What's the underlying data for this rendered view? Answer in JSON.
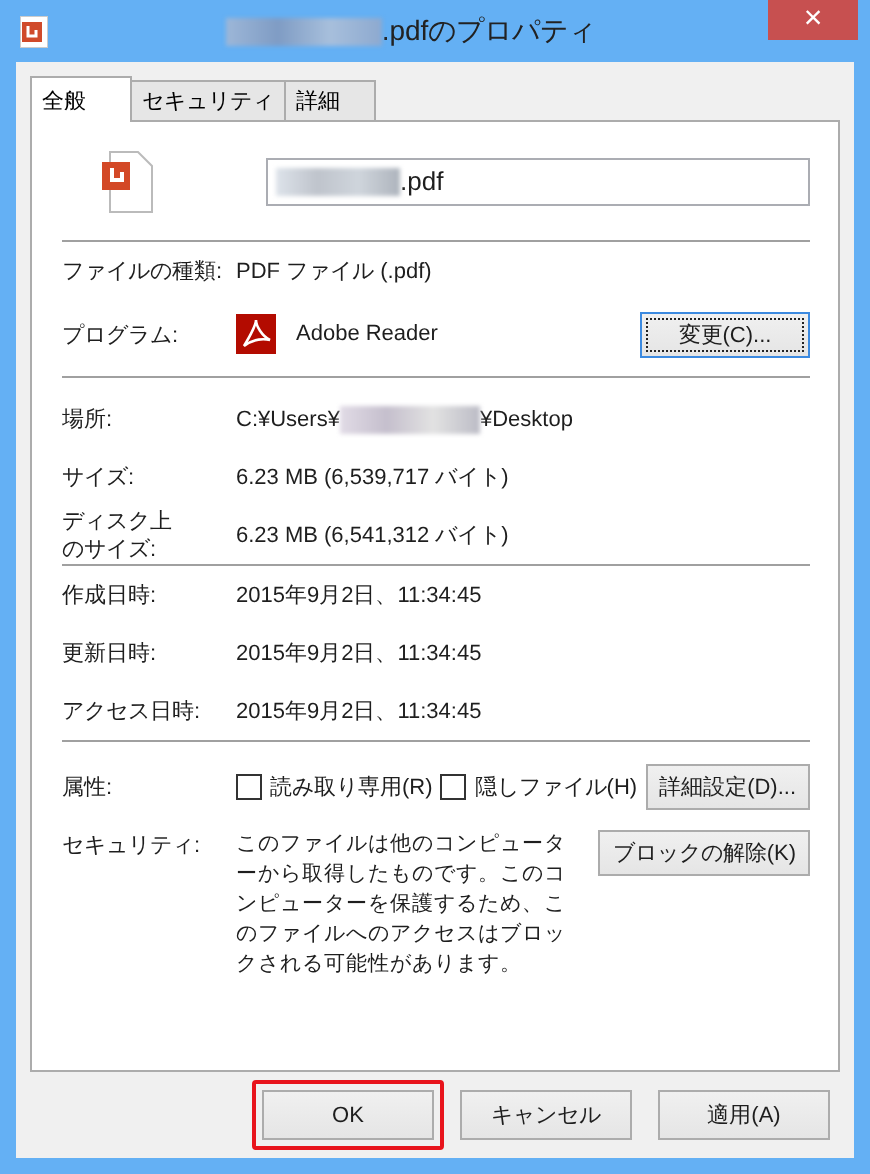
{
  "window": {
    "title": ".pdfのプロパティ",
    "close": "×"
  },
  "tabs": [
    {
      "label": "全般",
      "selected": true
    },
    {
      "label": "セキュリティ",
      "selected": false
    },
    {
      "label": "詳細",
      "selected": false
    }
  ],
  "file": {
    "name": ".pdf"
  },
  "type": {
    "label": "ファイルの種類:",
    "value": "PDF ファイル (.pdf)"
  },
  "program": {
    "label": "プログラム:",
    "value": "Adobe Reader",
    "button": "変更(C)...",
    "button_focused": true
  },
  "location": {
    "label": "場所:",
    "before": "C:¥Users¥",
    "after": "¥Desktop"
  },
  "sizes": [
    {
      "label": "サイズ:",
      "value": "6.23 MB (6,539,717 バイト)"
    },
    {
      "label": "ディスク上のサイズ:",
      "value": "6.23 MB (6,541,312 バイト)"
    }
  ],
  "dates": [
    {
      "label": "作成日時:",
      "value": "2015年9月2日、11:34:45"
    },
    {
      "label": "更新日時:",
      "value": "2015年9月2日、11:34:45"
    },
    {
      "label": "アクセス日時:",
      "value": "2015年9月2日、11:34:45"
    }
  ],
  "attributes": {
    "label": "属性:",
    "checkboxes": [
      {
        "label": "読み取り専用(R)",
        "checked": false
      },
      {
        "label": "隠しファイル(H)",
        "checked": false
      }
    ],
    "button": "詳細設定(D)..."
  },
  "security": {
    "label": "セキュリティ:",
    "text": "このファイルは他のコンピューターから取得したものです。このコンピューターを保護するため、このファイルへのアクセスはブロックされる可能性があります。",
    "button": "ブロックの解除(K)"
  },
  "buttons": [
    {
      "label": "OK",
      "highlighted": true
    },
    {
      "label": "キャンセル",
      "highlighted": false
    },
    {
      "label": "適用(A)",
      "highlighted": false
    }
  ]
}
